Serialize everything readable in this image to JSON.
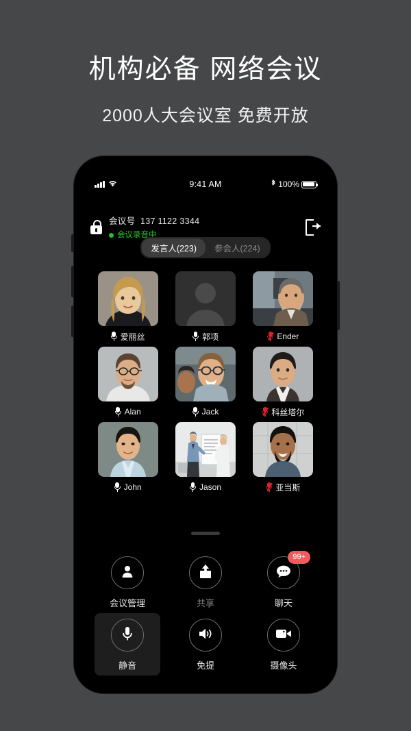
{
  "promo": {
    "title": "机构必备 网络会议",
    "subtitle": "2000人大会议室 免费开放"
  },
  "phone": {
    "status_bar": {
      "time": "9:41 AM",
      "battery_percent": "100%",
      "signal_icon": "cellular-bars-icon",
      "wifi_icon": "wifi-icon",
      "bluetooth_icon": "bluetooth-icon",
      "battery_icon": "battery-full-icon"
    },
    "meeting_header": {
      "lock_icon": "unlocked-padlock-icon",
      "meeting_id_label": "会议号",
      "meeting_id": "137 1122 3344",
      "recording_status": "会议录音中",
      "recording_dot_color": "#21c521",
      "exit_icon": "exit-door-icon"
    },
    "tabs": [
      {
        "label": "发言人(223)",
        "active": true
      },
      {
        "label": "参会人(224)",
        "active": false
      }
    ],
    "participants": [
      {
        "name": "爱丽丝",
        "muted": false,
        "avatar": "woman-blonde-black-top"
      },
      {
        "name": "郭项",
        "muted": false,
        "avatar": "placeholder-silhouette"
      },
      {
        "name": "Ender",
        "muted": true,
        "avatar": "man-beard-glasses-office"
      },
      {
        "name": "Alan",
        "muted": false,
        "avatar": "man-glasses-white-tee"
      },
      {
        "name": "Jack",
        "muted": false,
        "avatar": "man-glasses-blue-shirt"
      },
      {
        "name": "科丝塔尔",
        "muted": true,
        "avatar": "man-dark-hair-suit"
      },
      {
        "name": "John",
        "muted": false,
        "avatar": "man-asian-light-blue-shirt"
      },
      {
        "name": "Jason",
        "muted": false,
        "avatar": "man-whiteboard-presentation"
      },
      {
        "name": "亚当斯",
        "muted": true,
        "avatar": "man-beard-blue-shirt"
      }
    ],
    "drag_handle": "sheet-drag-handle",
    "controls": [
      {
        "label": "会议管理",
        "icon": "person-icon",
        "badge": null,
        "highlight": false,
        "dim": false
      },
      {
        "label": "共享",
        "icon": "share-upload-icon",
        "badge": null,
        "highlight": false,
        "dim": true
      },
      {
        "label": "聊天",
        "icon": "chat-bubble-icon",
        "badge": "99+",
        "highlight": false,
        "dim": false
      },
      {
        "label": "静音",
        "icon": "microphone-icon",
        "badge": null,
        "highlight": true,
        "dim": false
      },
      {
        "label": "免提",
        "icon": "speaker-icon",
        "badge": null,
        "highlight": false,
        "dim": false
      },
      {
        "label": "摄像头",
        "icon": "video-camera-icon",
        "badge": null,
        "highlight": false,
        "dim": false
      }
    ],
    "colors": {
      "badge": "#f25a5f",
      "recording": "#21c521",
      "muted_mic": "#d8232a",
      "screen_bg": "#000000",
      "page_bg": "#464749"
    }
  }
}
